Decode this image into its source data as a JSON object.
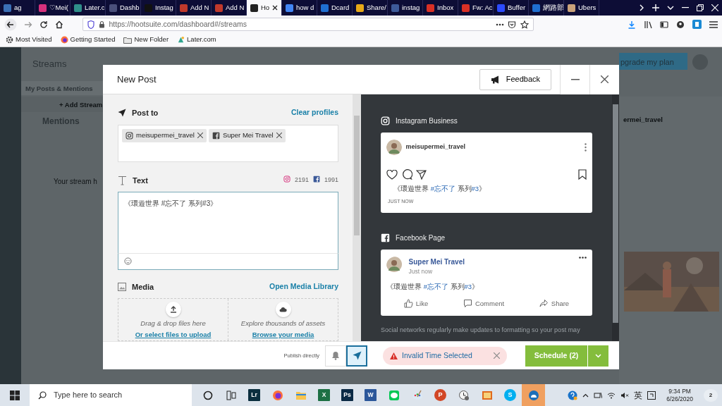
{
  "browser": {
    "tabs": [
      {
        "label": "ag",
        "color": "#3b6fb6",
        "selected": false
      },
      {
        "label": "♡Mei(",
        "color": "#d6317c",
        "selected": false
      },
      {
        "label": "Later.c",
        "color": "#2f8f8a",
        "selected": false
      },
      {
        "label": "Dashb",
        "color": "#4a4f7a",
        "selected": false
      },
      {
        "label": "Instag",
        "color": "#111111",
        "selected": false
      },
      {
        "label": "Add N",
        "color": "#c0392b",
        "selected": false
      },
      {
        "label": "Add N",
        "color": "#c0392b",
        "selected": false
      },
      {
        "label": "Ho",
        "color": "#222222",
        "selected": true
      },
      {
        "label": "how d",
        "color": "#4285f4",
        "selected": false
      },
      {
        "label": "Dcard",
        "color": "#1f6fd1",
        "selected": false
      },
      {
        "label": "Share/",
        "color": "#e6a817",
        "selected": false
      },
      {
        "label": "instag",
        "color": "#3d5a99",
        "selected": false
      },
      {
        "label": "Inbox",
        "color": "#d93025",
        "selected": false
      },
      {
        "label": "Fw: Ac",
        "color": "#d93025",
        "selected": false
      },
      {
        "label": "Buffer",
        "color": "#2c4bff",
        "selected": false
      },
      {
        "label": "網路部",
        "color": "#1f6fd1",
        "selected": false
      },
      {
        "label": "Ubers",
        "color": "#c9a27a",
        "selected": false
      }
    ],
    "url": "https://hootsuite.com/dashboard#/streams",
    "bookmarks": [
      {
        "kind": "gear",
        "label": "Most Visited"
      },
      {
        "kind": "firefox",
        "label": "Getting Started"
      },
      {
        "kind": "folder",
        "label": "New Folder"
      },
      {
        "kind": "later",
        "label": "Later.com"
      }
    ]
  },
  "app": {
    "title": "Streams",
    "stream_tab": "My Posts & Mentions",
    "add_stream": "+ Add Stream",
    "column_title": "Mentions",
    "empty_text": "Your stream h",
    "upgrade": "pgrade my plan",
    "side_column_title": "ermei_travel"
  },
  "modal": {
    "title": "New Post",
    "feedback": "Feedback",
    "post_to": {
      "label": "Post to",
      "clear": "Clear profiles",
      "profiles": [
        {
          "kind": "instagram",
          "name": "meisupermei_travel"
        },
        {
          "kind": "facebook",
          "name": "Super Mei Travel"
        }
      ]
    },
    "text": {
      "label": "Text",
      "counts": [
        {
          "kind": "instagram",
          "value": "2191"
        },
        {
          "kind": "facebook",
          "value": "1991"
        }
      ],
      "value": "《環遊世界 #忘不了 系列#3》"
    },
    "media": {
      "label": "Media",
      "link": "Open Media Library",
      "drops": [
        {
          "kind": "upload",
          "hint": "Drag & drop files here",
          "link": "Or select files to upload"
        },
        {
          "kind": "cloud",
          "hint": "Explore thousands of assets",
          "link": "Browse your media"
        }
      ]
    },
    "previews": [
      {
        "kind": "instagram",
        "network": "Instagram Business",
        "account": "meisupermei_travel",
        "time": "JUST NOW",
        "message": [
          {
            "kind": "plain",
            "text": "《環遊世界 "
          },
          {
            "kind": "hashtag",
            "text": "#忘不了"
          },
          {
            "kind": "plain",
            "text": " 系列"
          },
          {
            "kind": "hashtag",
            "text": "#3"
          },
          {
            "kind": "plain",
            "text": "》"
          }
        ]
      },
      {
        "kind": "facebook",
        "network": "Facebook Page",
        "account": "Super Mei Travel",
        "time": "Just now",
        "message": [
          {
            "kind": "plain",
            "text": "《環遊世界 "
          },
          {
            "kind": "hashtag",
            "text": "#忘不了"
          },
          {
            "kind": "plain",
            "text": " 系列"
          },
          {
            "kind": "hashtag",
            "text": "#3"
          },
          {
            "kind": "plain",
            "text": "》"
          }
        ],
        "actions": [
          {
            "kind": "like",
            "label": "Like"
          },
          {
            "kind": "comment",
            "label": "Comment"
          },
          {
            "kind": "share",
            "label": "Share"
          }
        ]
      }
    ],
    "disclaimer": "Social networks regularly make updates to formatting so your post may",
    "footer": {
      "publish_label": "Publish directly",
      "modes": [
        {
          "kind": "bell",
          "selected": false
        },
        {
          "kind": "send",
          "selected": true
        }
      ],
      "alert": "Invalid Time Selected",
      "schedule": "Schedule (2)"
    }
  },
  "taskbar": {
    "search_placeholder": "Type here to search",
    "apps": [
      {
        "kind": "cortana"
      },
      {
        "kind": "taskview"
      },
      {
        "kind": "tile",
        "glyph": "Lr",
        "color": "#0b2f3f"
      },
      {
        "kind": "firefox"
      },
      {
        "kind": "folder"
      },
      {
        "kind": "tile",
        "glyph": "X",
        "color": "#1d7044"
      },
      {
        "kind": "tile",
        "glyph": "Ps",
        "color": "#0b2a45"
      },
      {
        "kind": "tile",
        "glyph": "W",
        "color": "#2b579a"
      },
      {
        "kind": "line"
      },
      {
        "kind": "paint"
      },
      {
        "kind": "round",
        "glyph": "P",
        "color": "#d24726"
      },
      {
        "kind": "clock"
      },
      {
        "kind": "photos"
      },
      {
        "kind": "round",
        "glyph": "S",
        "color": "#00aff0"
      },
      {
        "kind": "hootsuite"
      }
    ],
    "ime": "英",
    "time": "9:34 PM",
    "date": "6/26/2020",
    "notifications": "2"
  }
}
